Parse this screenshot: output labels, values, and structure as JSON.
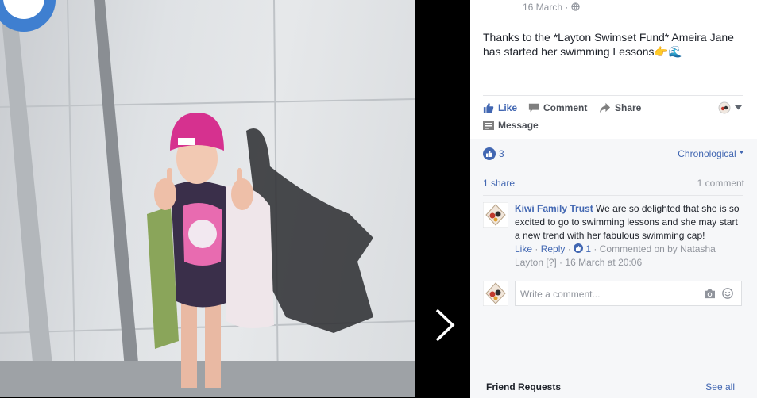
{
  "post": {
    "date": "16 March ·",
    "text": "Thanks to the *Layton Swimset Fund* Ameira Jane has started her swimming Lessons"
  },
  "actions": {
    "like": "Like",
    "comment": "Comment",
    "share": "Share",
    "message": "Message"
  },
  "stats": {
    "reactions_count": "3",
    "sort_label": "Chronological",
    "shares": "1 share",
    "comments": "1 comment"
  },
  "comment": {
    "author": "Kiwi Family Trust",
    "body": "We are so delighted that she is so excited to go to swimming lessons and she may start a new trend with her fabulous swimming cap!",
    "like": "Like",
    "reply": "Reply",
    "like_count": "1",
    "commented_on": "Commented on by Natasha Layton",
    "timestamp": "16 March at 20:06",
    "qmark": "[?]"
  },
  "composer": {
    "placeholder": "Write a comment..."
  },
  "footer": {
    "title": "Friend Requests",
    "see_all": "See all"
  },
  "colors": {
    "accent": "#4267b2",
    "text": "#1d2129",
    "meta": "#90949c"
  },
  "icons": [
    "globe-icon",
    "thumbs-up-icon",
    "comment-icon",
    "share-icon",
    "message-icon",
    "camera-icon",
    "emoji-icon",
    "chevron-right-icon",
    "dropdown-icon"
  ]
}
